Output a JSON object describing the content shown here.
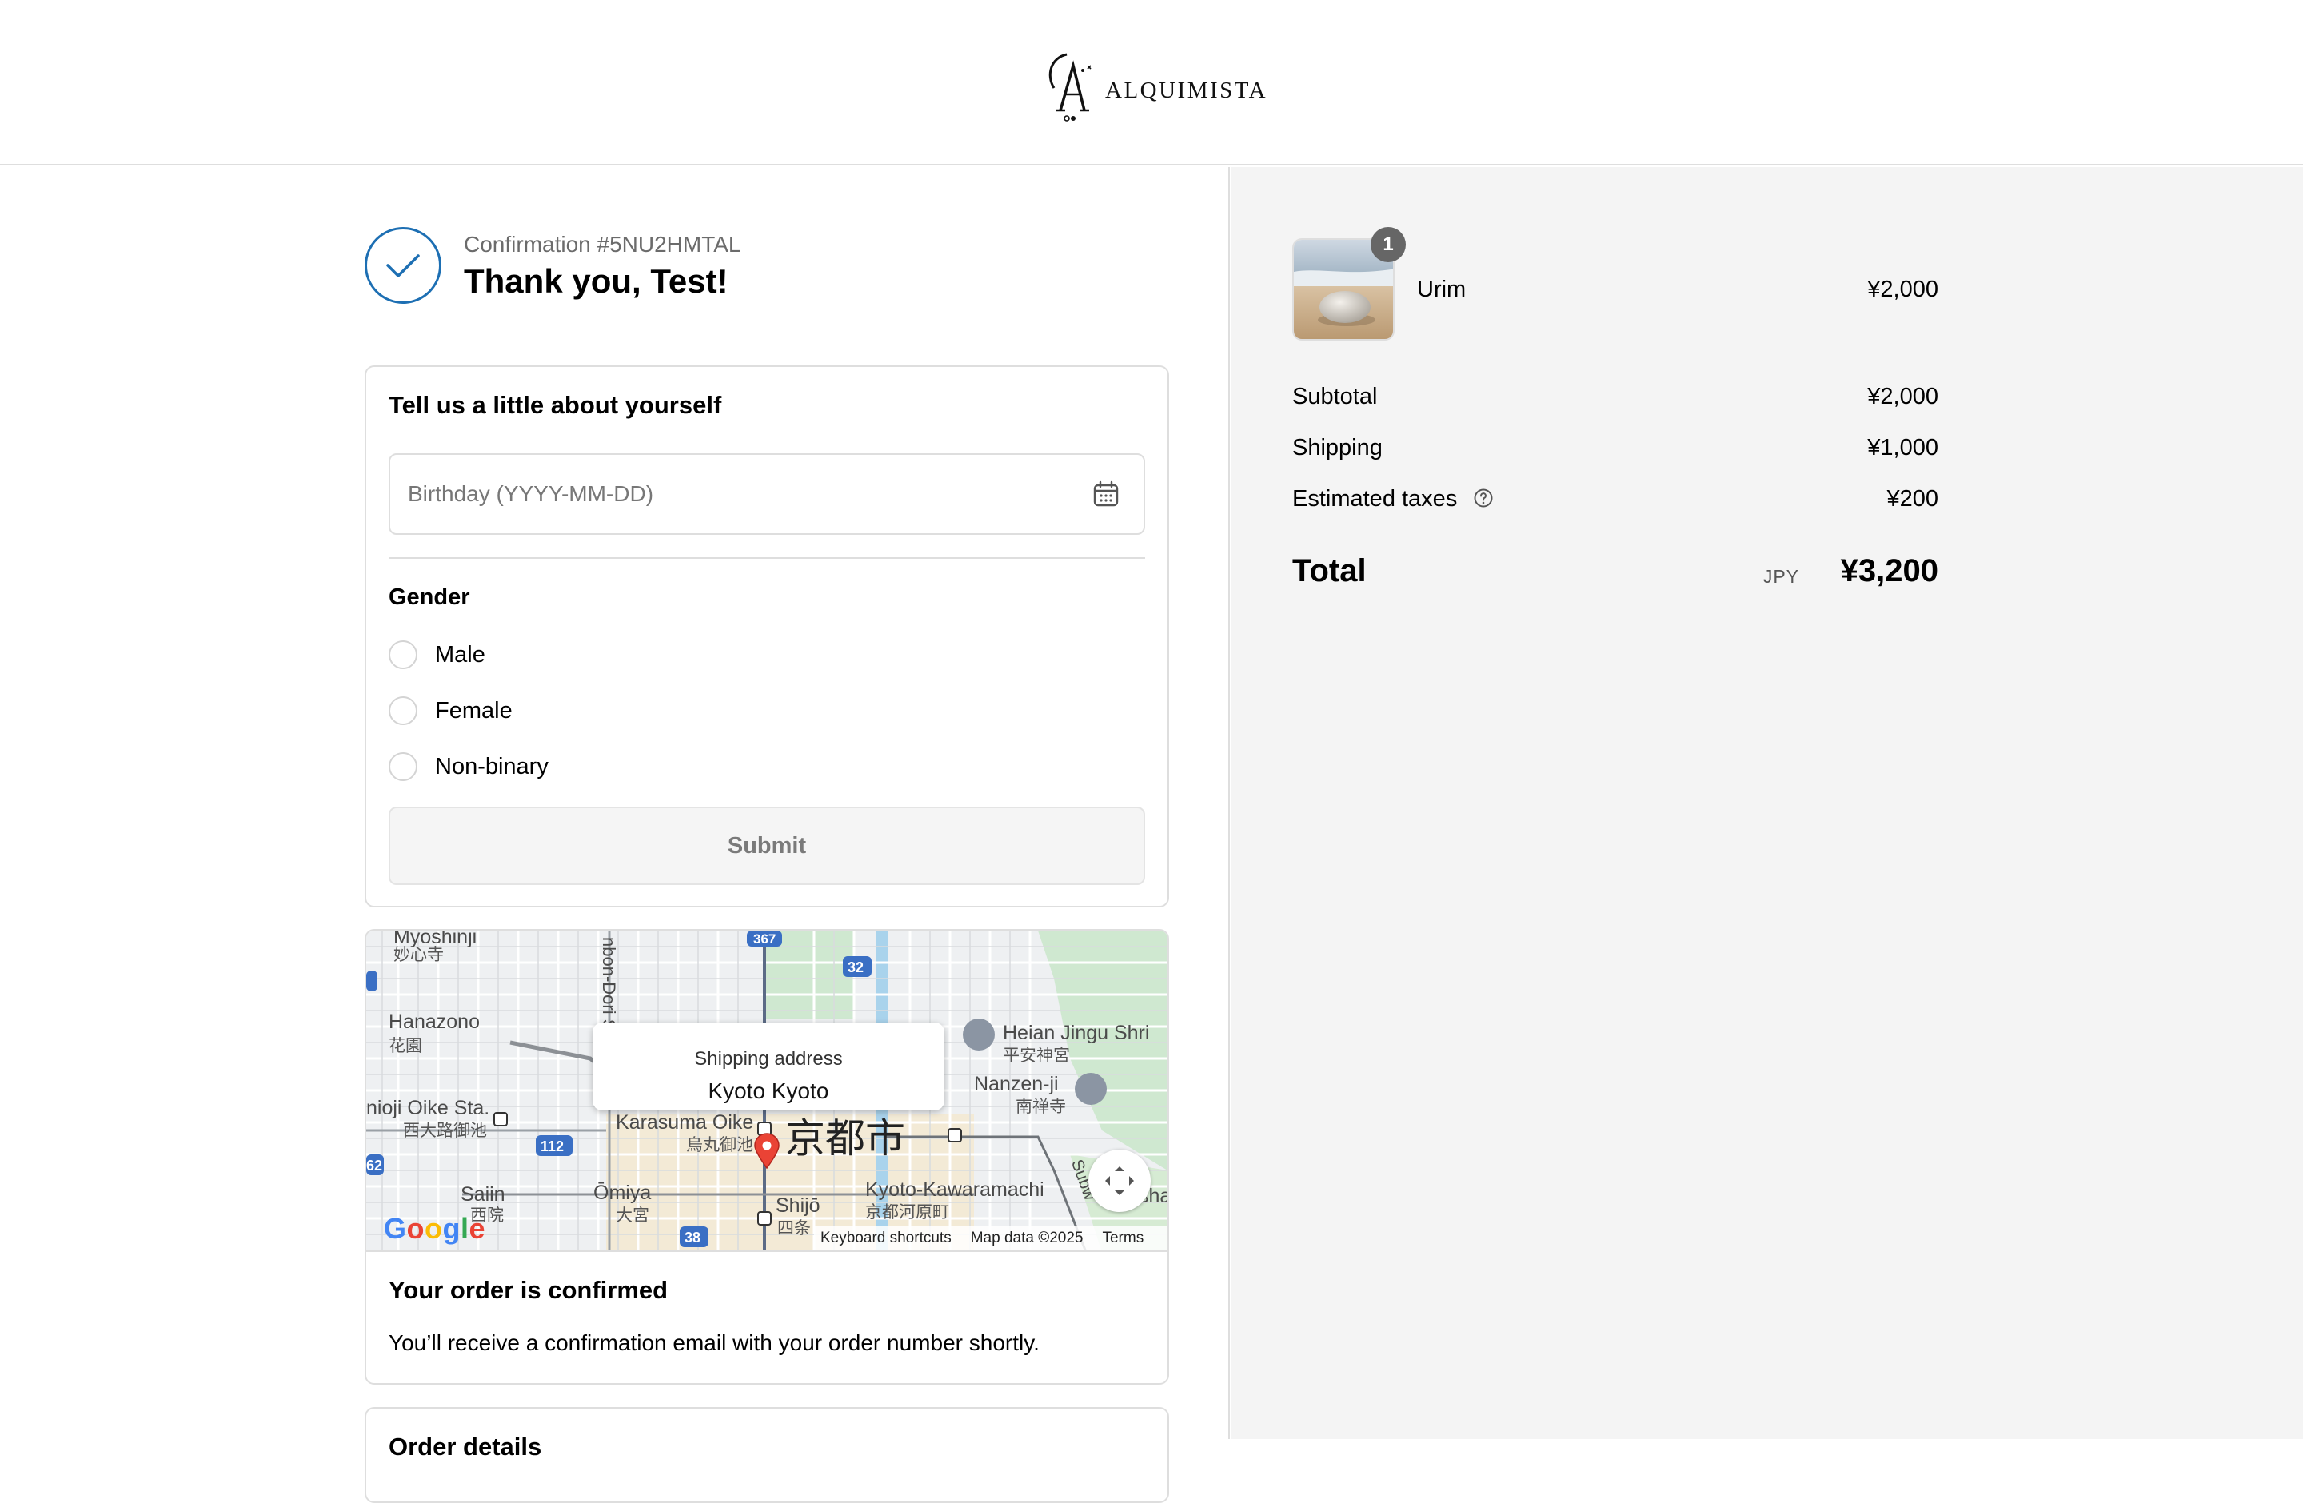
{
  "header": {
    "brand": "ALQUIMISTA"
  },
  "confirmation": {
    "number_label": "Confirmation #5NU2HMTAL",
    "thank_you": "Thank you, Test!"
  },
  "about_form": {
    "title": "Tell us a little about yourself",
    "birthday_placeholder": "Birthday (YYYY-MM-DD)",
    "birthday_value": "",
    "gender_label": "Gender",
    "gender_options": [
      "Male",
      "Female",
      "Non-binary"
    ],
    "submit_label": "Submit"
  },
  "map": {
    "popup_subtitle": "Shipping address",
    "popup_title": "Kyoto Kyoto",
    "labels": {
      "myoshinji": "Myoshinji",
      "myoshinji_jp": "妙心寺",
      "hanazono": "Hanazono",
      "hanazono_jp": "花園",
      "nishioji": "nioji Oike Sta.",
      "nishioji_jp": "西大路御池",
      "senbon": "nbon-Dori S",
      "karasuma": "Karasuma Oike",
      "karasuma_jp": "烏丸御池",
      "kyoto_city": "京都市",
      "heian": "Heian Jingu Shri",
      "heian_jp": "平安神宮",
      "nanzenji": "Nanzen-ji",
      "nanzenji_jp": "南禅寺",
      "saiin": "Saiin",
      "saiin_jp": "西院",
      "omiya": "Ōmiya",
      "omiya_jp": "大宮",
      "shijo": "Shijō",
      "shijo_jp": "四条",
      "kawaramachi": "Kyoto-Kawaramachi",
      "kawaramachi_jp": "京都河原町",
      "subway": "Subw",
      "sha": "sha",
      "route_367": "367",
      "route_32": "32",
      "route_112": "112",
      "route_38": "38",
      "route_162": "62"
    },
    "footer": {
      "shortcuts": "Keyboard shortcuts",
      "map_data": "Map data ©2025",
      "terms": "Terms"
    },
    "google_logo": [
      "G",
      "o",
      "o",
      "g",
      "l",
      "e"
    ]
  },
  "order_status": {
    "title": "Your order is confirmed",
    "message": "You’ll receive a confirmation email with your order number shortly."
  },
  "order_details": {
    "title": "Order details"
  },
  "summary": {
    "product": {
      "name": "Urim",
      "quantity": "1",
      "price": "¥2,000"
    },
    "subtotal_label": "Subtotal",
    "subtotal_value": "¥2,000",
    "shipping_label": "Shipping",
    "shipping_value": "¥1,000",
    "taxes_label": "Estimated taxes",
    "taxes_value": "¥200",
    "total_label": "Total",
    "total_currency": "JPY",
    "total_value": "¥3,200"
  },
  "colors": {
    "accent_blue": "#1d6fb3",
    "pin_red": "#ea4335",
    "sidebar_bg": "#f4f4f4"
  }
}
